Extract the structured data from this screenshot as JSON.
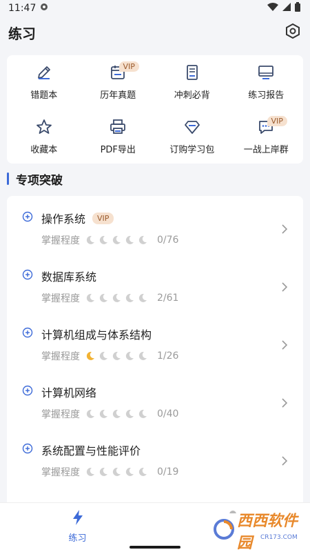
{
  "status": {
    "time": "11:47"
  },
  "header": {
    "title": "练习"
  },
  "grid": [
    {
      "label": "错题本",
      "icon": "pencil-icon",
      "vip": ""
    },
    {
      "label": "历年真题",
      "icon": "calendar-icon",
      "vip": "VIP"
    },
    {
      "label": "冲刺必背",
      "icon": "document-icon",
      "vip": ""
    },
    {
      "label": "练习报告",
      "icon": "monitor-icon",
      "vip": ""
    },
    {
      "label": "收藏本",
      "icon": "star-icon",
      "vip": ""
    },
    {
      "label": "PDF导出",
      "icon": "printer-icon",
      "vip": ""
    },
    {
      "label": "订购学习包",
      "icon": "diamond-icon",
      "vip": ""
    },
    {
      "label": "一战上岸群",
      "icon": "chat-icon",
      "vip": "VIP"
    }
  ],
  "section": {
    "title": "专项突破"
  },
  "topics": [
    {
      "name": "操作系统",
      "vip": "VIP",
      "progress_label": "掌握程度",
      "mastery": 0,
      "count": "0/76"
    },
    {
      "name": "数据库系统",
      "vip": "",
      "progress_label": "掌握程度",
      "mastery": 0,
      "count": "2/61"
    },
    {
      "name": "计算机组成与体系结构",
      "vip": "",
      "progress_label": "掌握程度",
      "mastery": 1,
      "count": "1/26"
    },
    {
      "name": "计算机网络",
      "vip": "",
      "progress_label": "掌握程度",
      "mastery": 0,
      "count": "0/40"
    },
    {
      "name": "系统配置与性能评价",
      "vip": "",
      "progress_label": "掌握程度",
      "mastery": 0,
      "count": "0/19"
    }
  ],
  "bottom_nav": {
    "tabs": [
      {
        "label": "练习",
        "icon": "lightning-icon"
      },
      {
        "label": "",
        "icon": "person-icon"
      }
    ]
  },
  "watermark": {
    "text": "西西软件园",
    "sub": "CR173.COM"
  },
  "colors": {
    "accent": "#3c6ad8",
    "vip_bg": "#f6e1cf",
    "vip_text": "#9a5a2c",
    "moon_active": "#f2b233",
    "moon_inactive": "#d0d0d0"
  }
}
